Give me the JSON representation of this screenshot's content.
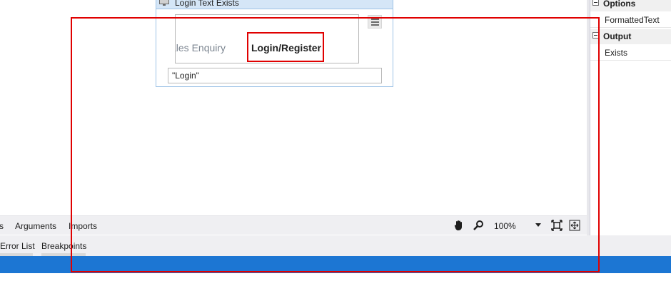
{
  "activity": {
    "title": "Login Text Exists",
    "preview_left_text": "ales Enquiry",
    "preview_highlight_text": "Login/Register",
    "input_value": "\"Login\""
  },
  "designer_bar": {
    "tab_partial": "s",
    "tab_arguments": "Arguments",
    "tab_imports": "Imports",
    "zoom": "100%",
    "icons": [
      "hand-pan-icon",
      "search-zoom-icon",
      "fit-to-screen-icon",
      "overview-icon"
    ]
  },
  "panel_tabs": {
    "error_list": "Error List",
    "breakpoints": "Breakpoints"
  },
  "properties": {
    "options_label": "Options",
    "formatted_text": "FormattedText",
    "output_label": "Output",
    "exists": "Exists"
  },
  "colors": {
    "status_bar": "#1c76d3",
    "highlight": "#e00000",
    "activity_border": "#9ec3e6"
  }
}
